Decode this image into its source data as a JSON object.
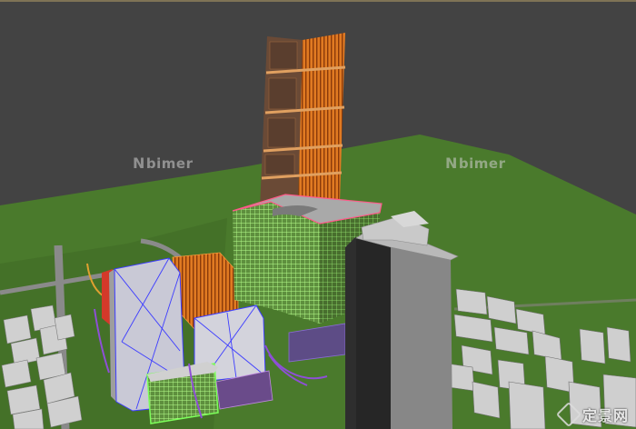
{
  "viewport": {
    "watermark_left": {
      "mark": "N",
      "text": "bimer"
    },
    "watermark_right": {
      "mark": "N",
      "text": "bimer"
    },
    "site_stamp": {
      "text": "定景网"
    }
  },
  "colors": {
    "background": "#434343",
    "ground": "#4a7a2c",
    "tower_orange": "#d9731f",
    "podium_green": "#8be06a",
    "block_white": "#c6c6c6",
    "wire_blue": "#3d3dff",
    "accent_purple": "#7b3fb0"
  }
}
